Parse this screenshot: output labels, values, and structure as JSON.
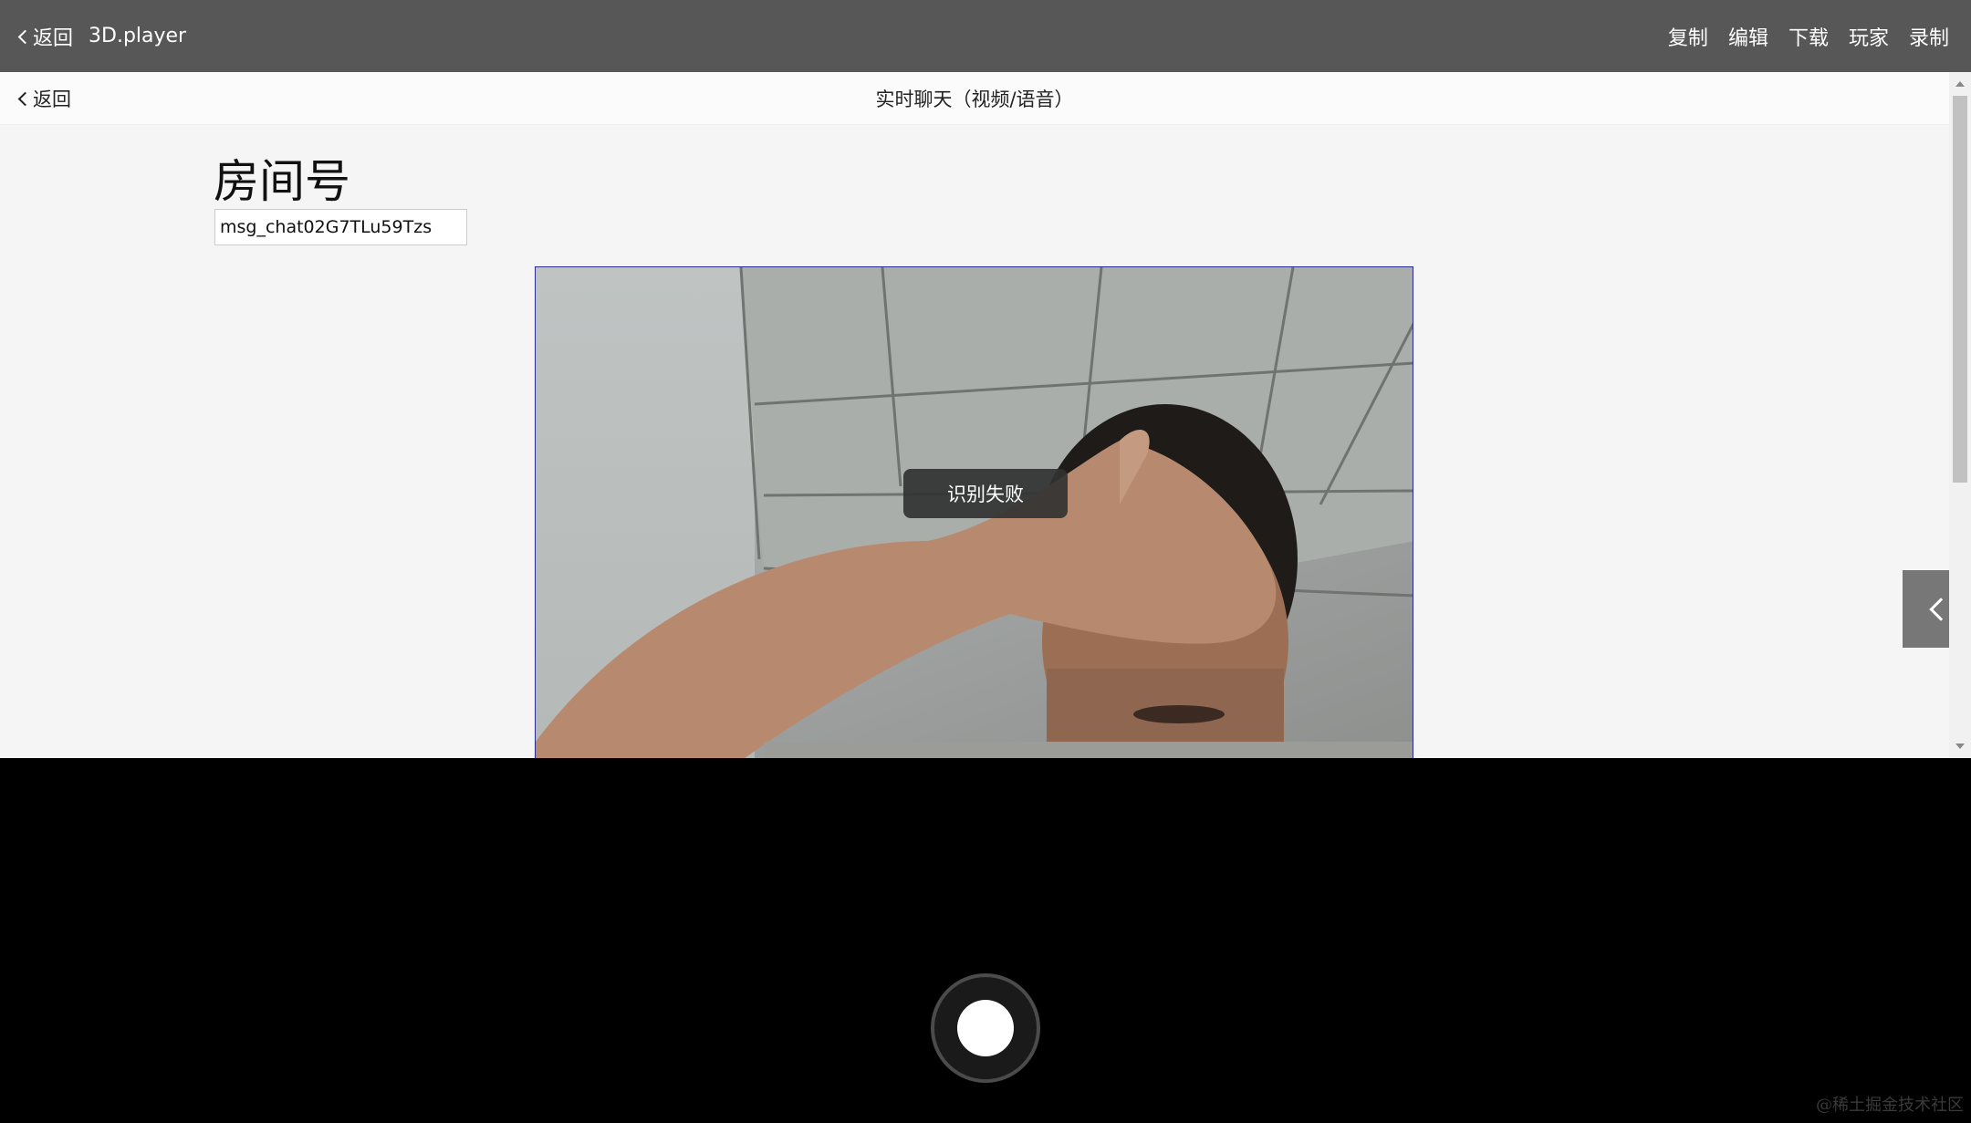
{
  "topbar": {
    "back_label": "返回",
    "app_title": "3D.player",
    "menu": [
      "复制",
      "编辑",
      "下载",
      "玩家",
      "录制"
    ]
  },
  "subbar": {
    "back_label": "返回",
    "title": "实时聊天（视频/语音）"
  },
  "room": {
    "heading": "房间号",
    "value": "msg_chat02G7TLu59Tzs"
  },
  "toast": {
    "text": "识别失败"
  },
  "watermark": "@稀土掘金技术社区",
  "icons": {
    "back": "chevron-left-icon",
    "side_tab": "chevron-left-icon",
    "shutter": "shutter-icon"
  }
}
